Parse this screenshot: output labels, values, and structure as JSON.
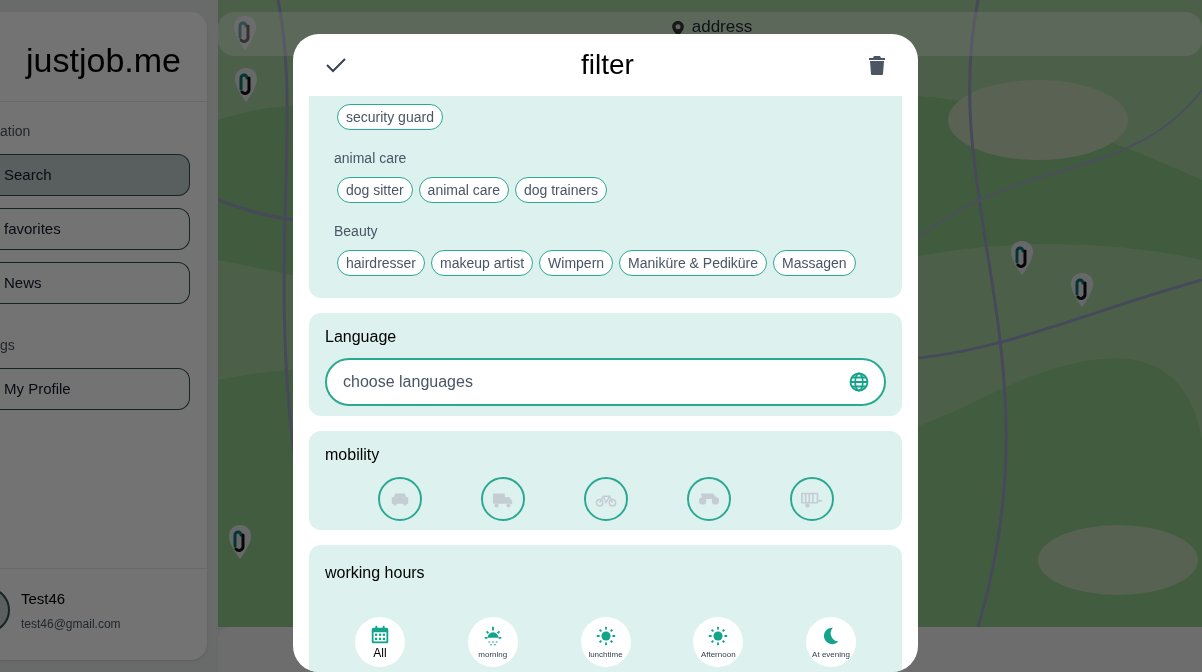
{
  "sidebar": {
    "logo": "justjob.me",
    "sections": [
      {
        "heading": "ation",
        "items": [
          {
            "label": "Search",
            "selected": true
          },
          {
            "label": "favorites",
            "selected": false
          },
          {
            "label": "News",
            "selected": false
          }
        ]
      },
      {
        "heading": "gs",
        "items": [
          {
            "label": "My Profile",
            "selected": false
          }
        ]
      }
    ],
    "user": {
      "name": "Test46",
      "email": "test46@gmail.com"
    }
  },
  "map": {
    "search_placeholder": "address"
  },
  "filter": {
    "title": "filter",
    "job_groups": [
      {
        "tags": [
          {
            "label": "security guard",
            "selected": false
          }
        ]
      },
      {
        "heading": "animal care",
        "tags": [
          {
            "label": "dog sitter",
            "selected": false
          },
          {
            "label": "animal care",
            "selected": false
          },
          {
            "label": "dog trainers",
            "selected": false
          }
        ]
      },
      {
        "heading": "Beauty",
        "tags": [
          {
            "label": "hairdresser",
            "selected": false
          },
          {
            "label": "makeup artist",
            "selected": false
          },
          {
            "label": "Wimpern",
            "selected": false
          },
          {
            "label": "Maniküre & Pediküre",
            "selected": false
          },
          {
            "label": "Massagen",
            "selected": false
          }
        ]
      }
    ],
    "language": {
      "heading": "Language",
      "placeholder": "choose languages"
    },
    "mobility": {
      "heading": "mobility",
      "options": [
        {
          "kind": "car",
          "selected": false
        },
        {
          "kind": "truck",
          "selected": false
        },
        {
          "kind": "bicycle",
          "selected": false
        },
        {
          "kind": "motorbike",
          "selected": false
        },
        {
          "kind": "trailer",
          "selected": false
        }
      ]
    },
    "working_hours": {
      "heading": "working hours",
      "options": [
        {
          "kind": "calendar",
          "label": "All",
          "selected": true
        },
        {
          "kind": "sunrise",
          "label": "morning",
          "selected": false
        },
        {
          "kind": "sun",
          "label": "lunchtime",
          "selected": false
        },
        {
          "kind": "sun",
          "label": "Afternoon",
          "selected": false
        },
        {
          "kind": "moon",
          "label": "At evening",
          "selected": false
        }
      ]
    }
  }
}
